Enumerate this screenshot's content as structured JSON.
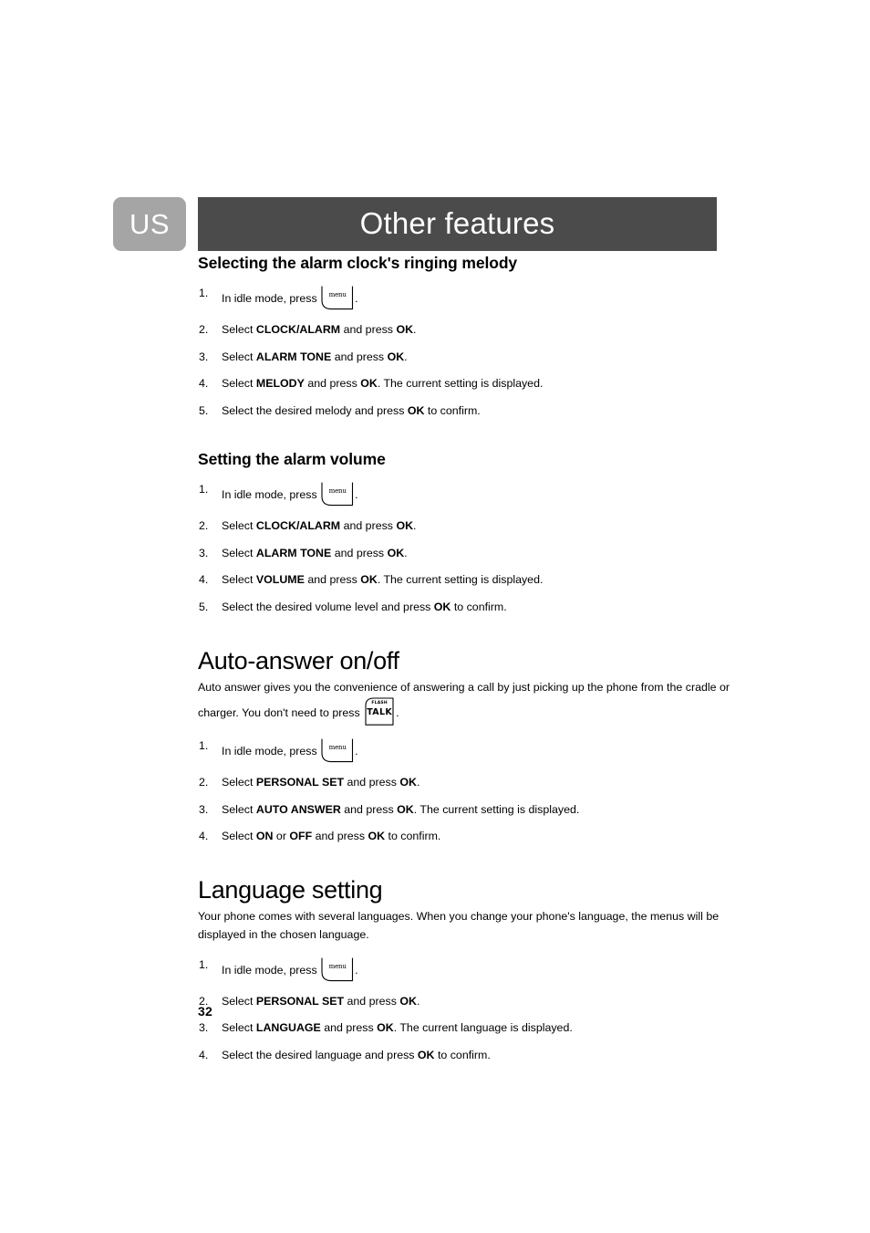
{
  "badge": {
    "label": "US"
  },
  "header": {
    "title": "Other features"
  },
  "page_number": "32",
  "keys": {
    "menu": {
      "label": "menu",
      "name": "menu-key-icon"
    },
    "talk": {
      "top_label": "FLASH",
      "main_label": "TALK",
      "name": "flash-talk-key-icon"
    }
  },
  "colors": {
    "badge_bg": "#a5a5a5",
    "title_bar_bg": "#4b4b4b",
    "text": "#000000",
    "paper": "#ffffff"
  },
  "sections": [
    {
      "id": "alarm-melody",
      "heading": "Selecting the alarm clock's ringing melody",
      "heading_level": "sub",
      "steps": [
        {
          "num": "1.",
          "pre": "In idle mode, press ",
          "key": "menu",
          "post": "."
        },
        {
          "num": "2.",
          "parts": [
            {
              "t": "Select ",
              "b": false
            },
            {
              "t": "CLOCK/ALARM",
              "b": true
            },
            {
              "t": " and press ",
              "b": false
            },
            {
              "t": "OK",
              "b": true
            },
            {
              "t": ".",
              "b": false
            }
          ]
        },
        {
          "num": "3.",
          "parts": [
            {
              "t": "Select ",
              "b": false
            },
            {
              "t": "ALARM TONE",
              "b": true
            },
            {
              "t": " and press ",
              "b": false
            },
            {
              "t": "OK",
              "b": true
            },
            {
              "t": ".",
              "b": false
            }
          ]
        },
        {
          "num": "4.",
          "parts": [
            {
              "t": "Select ",
              "b": false
            },
            {
              "t": "MELODY",
              "b": true
            },
            {
              "t": " and press ",
              "b": false
            },
            {
              "t": "OK",
              "b": true
            },
            {
              "t": ". The current setting is displayed.",
              "b": false
            }
          ]
        },
        {
          "num": "5.",
          "parts": [
            {
              "t": "Select the desired melody and press ",
              "b": false
            },
            {
              "t": "OK",
              "b": true
            },
            {
              "t": " to confirm.",
              "b": false
            }
          ]
        }
      ]
    },
    {
      "id": "alarm-volume",
      "heading": "Setting the alarm volume",
      "heading_level": "sub",
      "steps": [
        {
          "num": "1.",
          "pre": "In idle mode, press ",
          "key": "menu",
          "post": "."
        },
        {
          "num": "2.",
          "parts": [
            {
              "t": "Select ",
              "b": false
            },
            {
              "t": "CLOCK/ALARM",
              "b": true
            },
            {
              "t": " and press ",
              "b": false
            },
            {
              "t": "OK",
              "b": true
            },
            {
              "t": ".",
              "b": false
            }
          ]
        },
        {
          "num": "3.",
          "parts": [
            {
              "t": "Select ",
              "b": false
            },
            {
              "t": "ALARM TONE",
              "b": true
            },
            {
              "t": " and press ",
              "b": false
            },
            {
              "t": "OK",
              "b": true
            },
            {
              "t": ".",
              "b": false
            }
          ]
        },
        {
          "num": "4.",
          "parts": [
            {
              "t": "Select ",
              "b": false
            },
            {
              "t": "VOLUME",
              "b": true
            },
            {
              "t": " and press ",
              "b": false
            },
            {
              "t": "OK",
              "b": true
            },
            {
              "t": ". The current setting is displayed.",
              "b": false
            }
          ]
        },
        {
          "num": "5.",
          "parts": [
            {
              "t": "Select the desired volume level and press ",
              "b": false
            },
            {
              "t": "OK",
              "b": true
            },
            {
              "t": " to confirm.",
              "b": false
            }
          ]
        }
      ]
    },
    {
      "id": "auto-answer",
      "heading": "Auto-answer on/off",
      "heading_level": "big",
      "intro_line1": "Auto answer gives you the convenience of answering a call by just picking up the phone from the cradle or",
      "intro_line2_pre": "charger. You don't need to press ",
      "intro_line2_post": ".",
      "intro_key": "talk",
      "steps": [
        {
          "num": "1.",
          "pre": "In idle mode, press ",
          "key": "menu",
          "post": "."
        },
        {
          "num": "2.",
          "parts": [
            {
              "t": "Select ",
              "b": false
            },
            {
              "t": "PERSONAL SET",
              "b": true
            },
            {
              "t": " and press ",
              "b": false
            },
            {
              "t": "OK",
              "b": true
            },
            {
              "t": ".",
              "b": false
            }
          ]
        },
        {
          "num": "3.",
          "parts": [
            {
              "t": "Select ",
              "b": false
            },
            {
              "t": "AUTO ANSWER",
              "b": true
            },
            {
              "t": " and press ",
              "b": false
            },
            {
              "t": "OK",
              "b": true
            },
            {
              "t": ". The current setting is displayed.",
              "b": false
            }
          ]
        },
        {
          "num": "4.",
          "parts": [
            {
              "t": "Select ",
              "b": false
            },
            {
              "t": "ON",
              "b": true
            },
            {
              "t": " or ",
              "b": false
            },
            {
              "t": "OFF",
              "b": true
            },
            {
              "t": " and press ",
              "b": false
            },
            {
              "t": "OK",
              "b": true
            },
            {
              "t": " to confirm.",
              "b": false
            }
          ]
        }
      ]
    },
    {
      "id": "language-setting",
      "heading": "Language setting",
      "heading_level": "big",
      "intro_line1": "Your phone comes with several languages.  When you change your phone's language, the menus will be",
      "intro_line2": "displayed in the chosen language.",
      "steps": [
        {
          "num": "1.",
          "pre": "In idle mode, press ",
          "key": "menu",
          "post": "."
        },
        {
          "num": "2.",
          "parts": [
            {
              "t": "Select ",
              "b": false
            },
            {
              "t": "PERSONAL SET",
              "b": true
            },
            {
              "t": " and press ",
              "b": false
            },
            {
              "t": "OK",
              "b": true
            },
            {
              "t": ".",
              "b": false
            }
          ]
        },
        {
          "num": "3.",
          "parts": [
            {
              "t": "Select ",
              "b": false
            },
            {
              "t": "LANGUAGE",
              "b": true
            },
            {
              "t": " and press ",
              "b": false
            },
            {
              "t": "OK",
              "b": true
            },
            {
              "t": ". The current language is displayed.",
              "b": false
            }
          ]
        },
        {
          "num": "4.",
          "parts": [
            {
              "t": "Select the desired language and press ",
              "b": false
            },
            {
              "t": "OK",
              "b": true
            },
            {
              "t": " to confirm.",
              "b": false
            }
          ]
        }
      ]
    }
  ]
}
